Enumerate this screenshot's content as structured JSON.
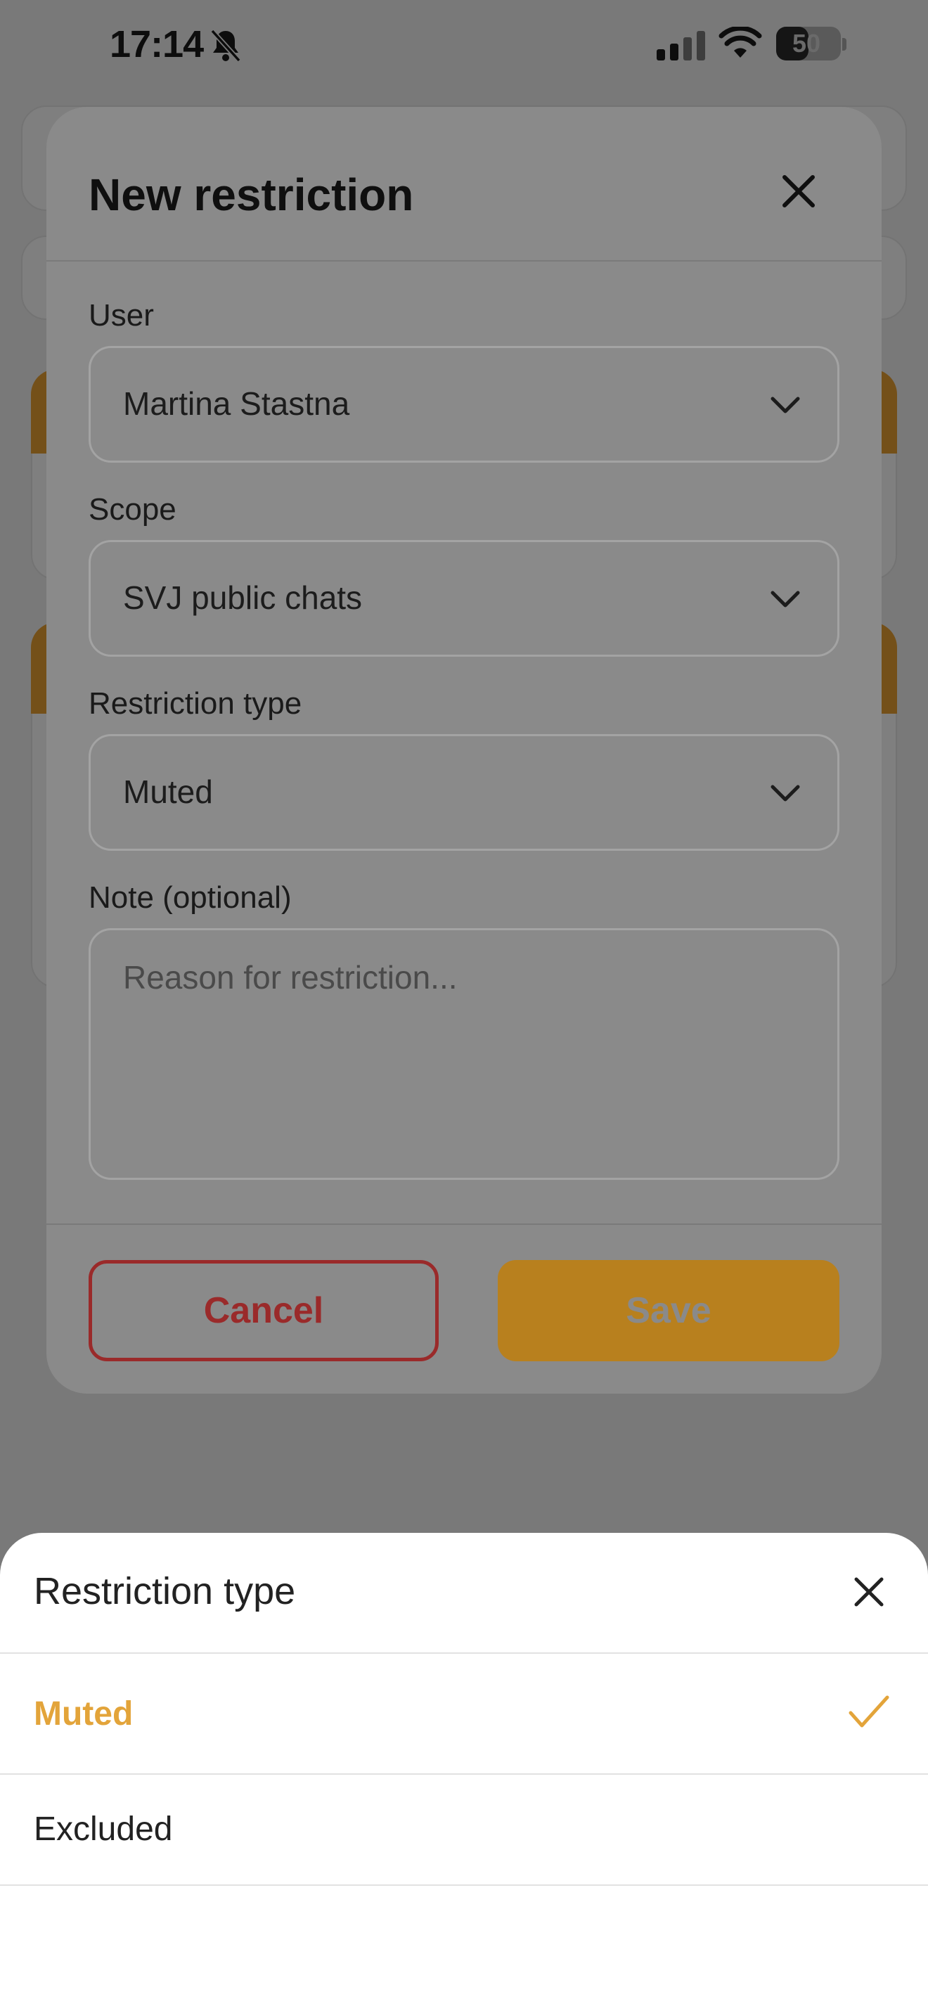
{
  "status_bar": {
    "time": "17:14",
    "battery_percent": "50",
    "icons": [
      "bell-slash-icon",
      "cellular-signal-icon",
      "wifi-icon",
      "battery-icon"
    ]
  },
  "dialog": {
    "title": "New restriction",
    "close_icon": "close-icon",
    "fields": {
      "user": {
        "label": "User",
        "value": "Martina Stastna"
      },
      "scope": {
        "label": "Scope",
        "value": "SVJ public chats"
      },
      "restriction_type": {
        "label": "Restriction type",
        "value": "Muted"
      },
      "note": {
        "label": "Note (optional)",
        "placeholder": "Reason for restriction..."
      }
    },
    "buttons": {
      "cancel": "Cancel",
      "save": "Save"
    }
  },
  "sheet": {
    "title": "Restriction type",
    "options": [
      {
        "label": "Muted",
        "selected": true
      },
      {
        "label": "Excluded",
        "selected": false
      }
    ]
  },
  "colors": {
    "accent": "#e8a133",
    "selected_option": "#e3a43a",
    "cancel": "#9a2a2a",
    "overlay": "#000000"
  }
}
